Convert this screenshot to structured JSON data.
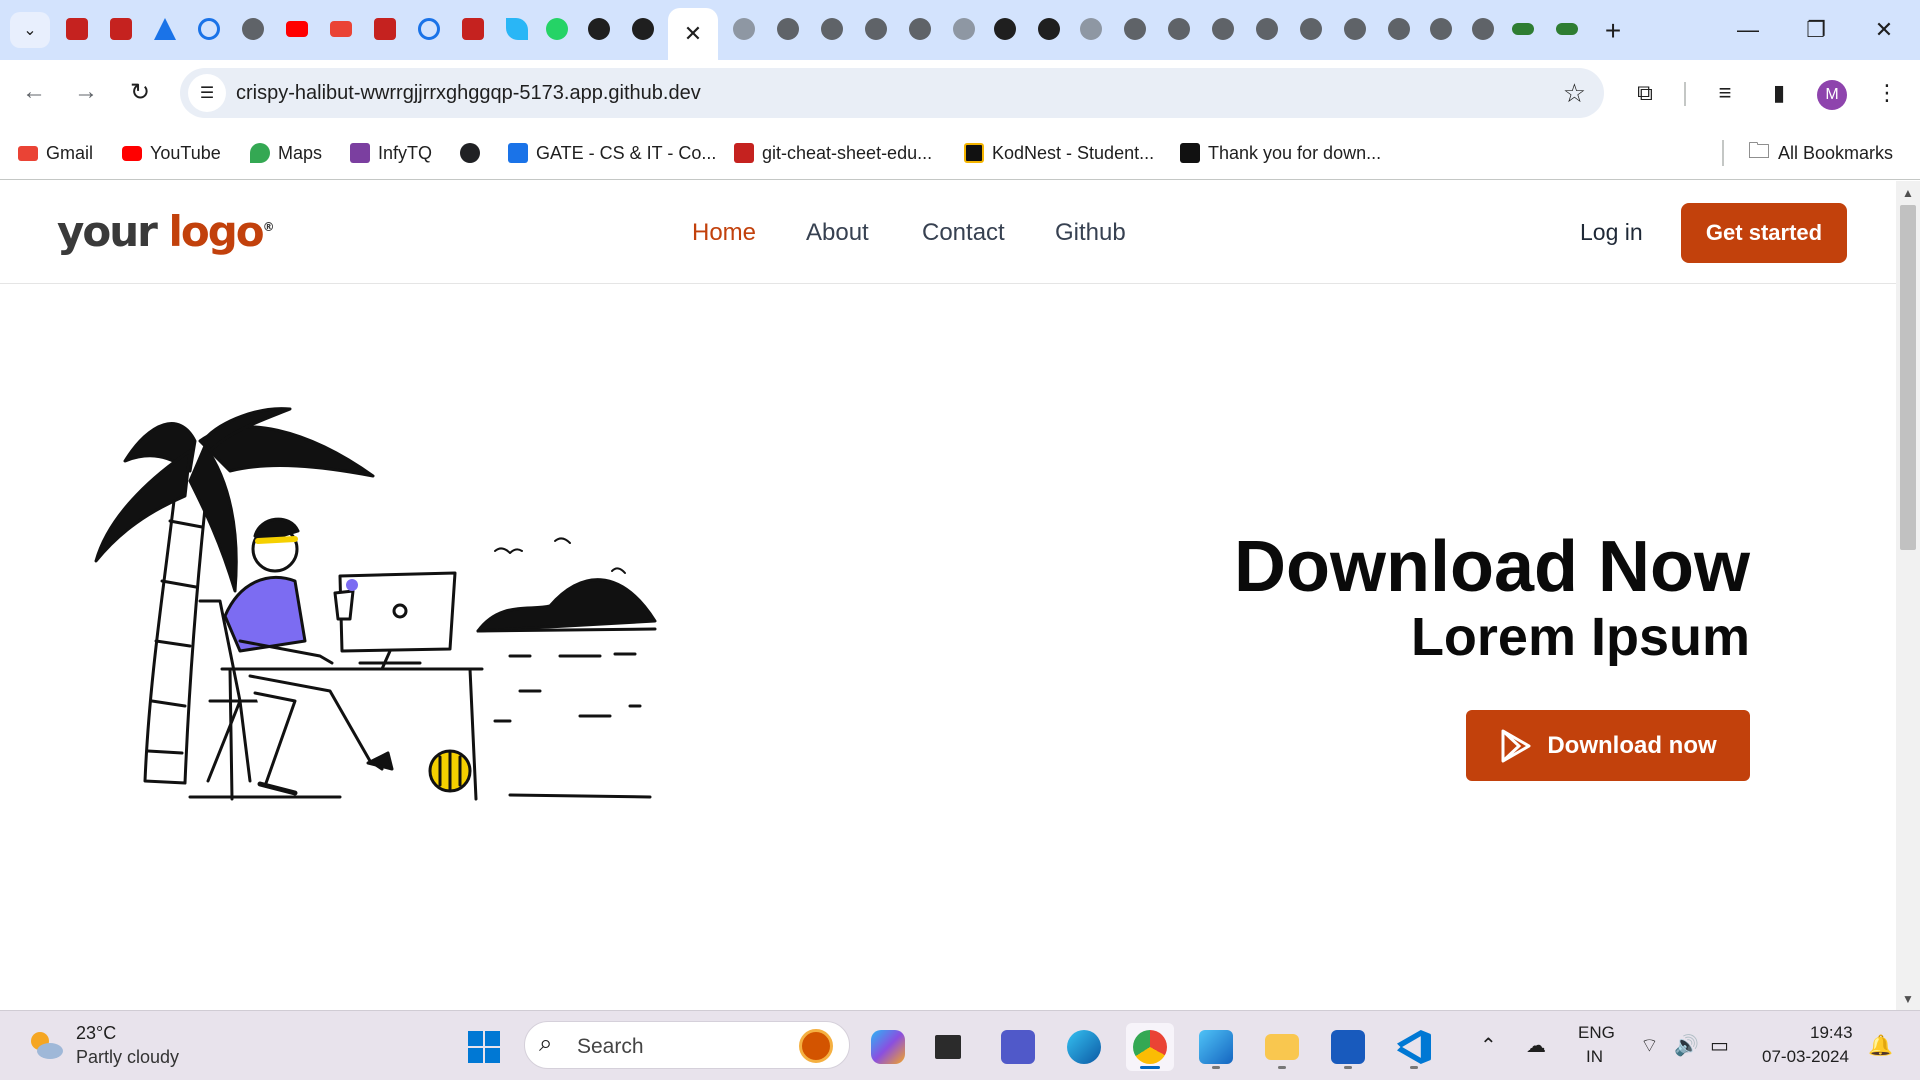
{
  "browser": {
    "active_tab_close": "✕",
    "new_tab": "+",
    "url": "crispy-halibut-wwrrgjjrrxghggqp-5173.app.github.dev",
    "bookmarks": [
      {
        "label": "Gmail",
        "color": "#ea4335"
      },
      {
        "label": "YouTube",
        "color": "#ff0000"
      },
      {
        "label": "Maps",
        "color": "#34a853"
      },
      {
        "label": "InfyTQ",
        "color": "#7b3fa0"
      },
      {
        "label": "",
        "color": "#202124"
      },
      {
        "label": "GATE - CS & IT - Co...",
        "color": "#1a73e8"
      },
      {
        "label": "git-cheat-sheet-edu...",
        "color": "#c5221f"
      },
      {
        "label": "KodNest - Student...",
        "color": "#f4b400"
      },
      {
        "label": "Thank you for down...",
        "color": "#111111"
      }
    ],
    "all_bookmarks": "All Bookmarks",
    "profile_initial": "M"
  },
  "site": {
    "logo_prefix": "your ",
    "logo_accent": "logo",
    "logo_mark": "®",
    "nav": [
      {
        "label": "Home",
        "active": true
      },
      {
        "label": "About",
        "active": false
      },
      {
        "label": "Contact",
        "active": false
      },
      {
        "label": "Github",
        "active": false
      }
    ],
    "login": "Log in",
    "cta": "Get started",
    "accent_color": "#c2410c"
  },
  "hero": {
    "title": "Download Now",
    "subtitle": "Lorem Ipsum",
    "button": "Download now"
  },
  "taskbar": {
    "temperature": "23°C",
    "weather": "Partly cloudy",
    "search_placeholder": "Search",
    "language": "ENG",
    "region": "IN",
    "time": "19:43",
    "date": "07-03-2024"
  }
}
